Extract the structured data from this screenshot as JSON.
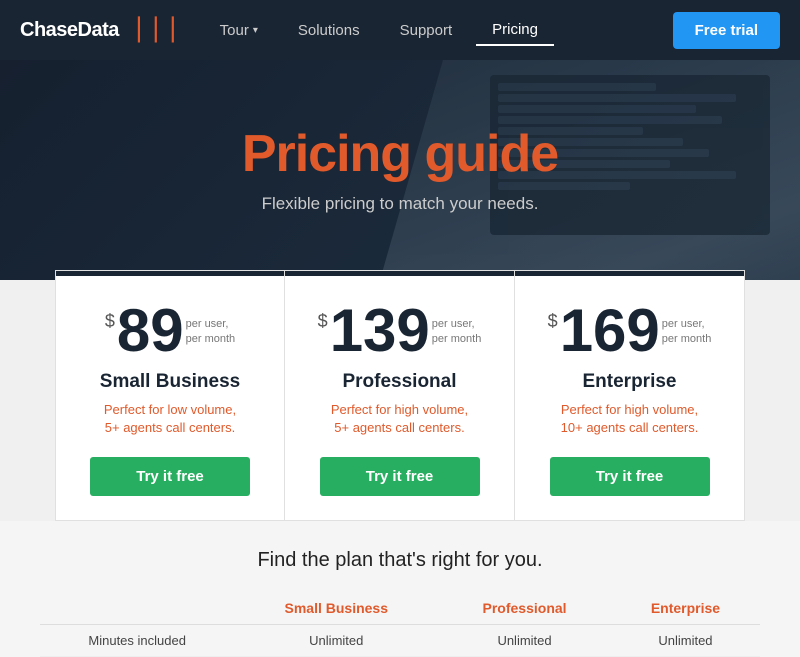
{
  "navbar": {
    "logo": "ChaseData",
    "nav_items": [
      {
        "label": "Tour",
        "has_dropdown": true,
        "active": false
      },
      {
        "label": "Solutions",
        "active": false
      },
      {
        "label": "Support",
        "active": false
      },
      {
        "label": "Pricing",
        "active": true
      }
    ],
    "cta_label": "Free trial"
  },
  "hero": {
    "title": "Pricing guide",
    "subtitle": "Flexible pricing to match your needs."
  },
  "plans": [
    {
      "dollar": "$",
      "price": "89",
      "period_line1": "per user,",
      "period_line2": "per month",
      "name": "Small Business",
      "desc": "Perfect for low volume,\n5+ agents call centers.",
      "cta": "Try it free"
    },
    {
      "dollar": "$",
      "price": "139",
      "period_line1": "per user,",
      "period_line2": "per month",
      "name": "Professional",
      "desc": "Perfect for high volume,\n5+ agents call centers.",
      "cta": "Try it free"
    },
    {
      "dollar": "$",
      "price": "169",
      "period_line1": "per user,",
      "period_line2": "per month",
      "name": "Enterprise",
      "desc": "Perfect for high volume,\n10+ agents call centers.",
      "cta": "Try it free"
    }
  ],
  "comparison": {
    "title": "Find the plan that's right for you.",
    "columns": [
      "",
      "Small Business",
      "Professional",
      "Enterprise"
    ],
    "rows": [
      {
        "label": "Minutes included",
        "small": "Unlimited",
        "pro": "Unlimited",
        "ent": "Unlimited"
      }
    ]
  }
}
